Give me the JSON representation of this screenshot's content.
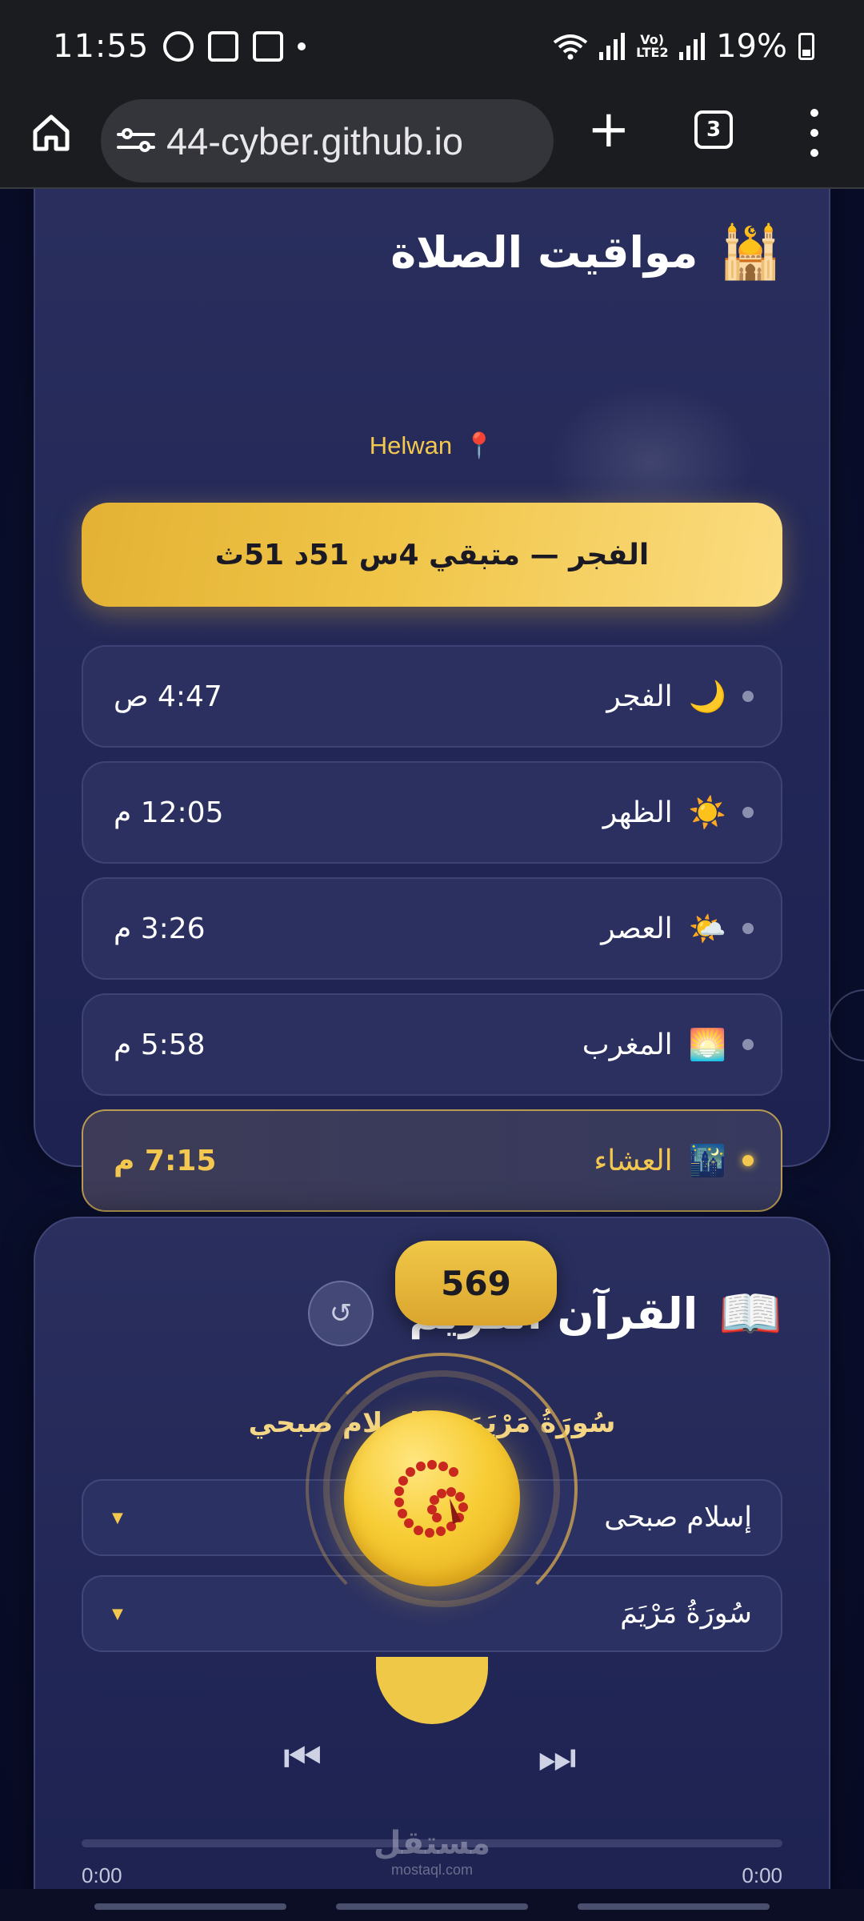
{
  "status_bar": {
    "time": "11:55",
    "icons": [
      "whatsapp-icon",
      "incognito-icon",
      "gallery-icon"
    ],
    "network_label": "Vo) LTE2",
    "battery": "19%"
  },
  "browser": {
    "url": "44-cyber.github.io",
    "tab_count": "3"
  },
  "prayer": {
    "title": "مواقيت الصلاة",
    "title_emoji": "🕌",
    "location": "Helwan",
    "location_emoji": "📍",
    "countdown": "الفجر — متبقي 4س 51د 51ث",
    "items": [
      {
        "emoji": "🌙",
        "name": "الفجر",
        "time": "4:47 ص"
      },
      {
        "emoji": "☀️",
        "name": "الظهر",
        "time": "12:05 م"
      },
      {
        "emoji": "🌤️",
        "name": "العصر",
        "time": "3:26 م"
      },
      {
        "emoji": "🌅",
        "name": "المغرب",
        "time": "5:58 م"
      },
      {
        "emoji": "🌃",
        "name": "العشاء",
        "time": "7:15 م"
      }
    ],
    "active_index": 4
  },
  "quran": {
    "title": "القرآن الكريم",
    "title_emoji": "📖",
    "now_playing": "سُورَةُ مَرْيَمَ — إسلام صبحي",
    "reciter_select": "إسلام صبحى",
    "surah_select": "سُورَةُ مَرْيَمَ",
    "time_current": "0:00",
    "time_total": "0:00",
    "progress": 0
  },
  "tasbeeh": {
    "count": "569",
    "reset_glyph": "↺"
  },
  "controls": {
    "prev": "⏮",
    "next": "⏭"
  },
  "watermark": {
    "ar": "مستقل",
    "en": "mostaql.com"
  },
  "colors": {
    "accent": "#f4c84e",
    "card": "#252a5a",
    "background": "#0b1030"
  }
}
